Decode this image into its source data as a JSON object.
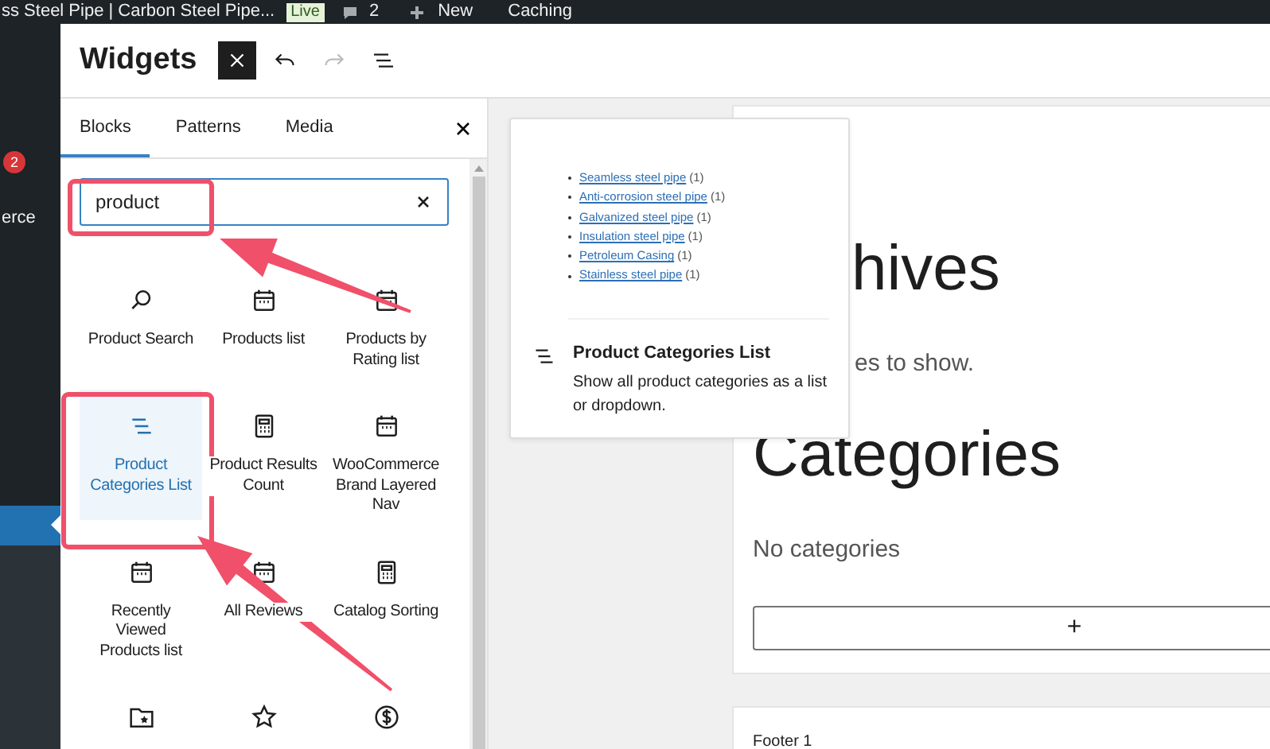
{
  "admin_bar": {
    "site_title": "ss Steel Pipe | Carbon Steel Pipe...",
    "live_badge": "Live",
    "comments_count": "2",
    "new_label": "New",
    "caching_label": "Caching"
  },
  "admin_menu": {
    "items": [
      {
        "kind": "badge",
        "text": "2",
        "selected": false
      },
      {
        "kind": "label",
        "text": "erce",
        "selected": false
      },
      {
        "kind": "blank",
        "selected": true
      }
    ]
  },
  "header": {
    "title": "Widgets",
    "tools": [
      {
        "kind": "close",
        "disabled": false
      },
      {
        "kind": "undo",
        "disabled": false
      },
      {
        "kind": "redo",
        "disabled": true
      },
      {
        "kind": "list-view",
        "disabled": false
      }
    ]
  },
  "inserter": {
    "tabs": [
      {
        "label": "Blocks",
        "selected": true
      },
      {
        "label": "Patterns",
        "selected": false
      },
      {
        "label": "Media",
        "selected": false
      }
    ],
    "search": {
      "value": "product"
    },
    "blocks": [
      {
        "label": "Product Search",
        "kind": "search",
        "selected": false
      },
      {
        "label": "Products list",
        "kind": "calendar",
        "selected": false
      },
      {
        "label": "Products by Rating list",
        "kind": "calendar",
        "selected": false
      },
      {
        "label": "Product Categories List",
        "kind": "lines",
        "selected": true
      },
      {
        "label": "Product Results Count",
        "kind": "calculator",
        "selected": false
      },
      {
        "label": "WooCommerce Brand Layered Nav",
        "kind": "calendar",
        "selected": false
      },
      {
        "label": "Recently Viewed Products list",
        "kind": "calendar",
        "selected": false
      },
      {
        "label": "All Reviews",
        "kind": "calendar",
        "selected": false
      },
      {
        "label": "Catalog Sorting",
        "kind": "calculator",
        "selected": false
      },
      {
        "kind": "folder-star",
        "selected": false
      },
      {
        "kind": "star",
        "selected": false
      },
      {
        "kind": "dollar",
        "selected": false
      }
    ]
  },
  "preview": {
    "items": [
      {
        "label": "Seamless steel pipe",
        "count": "(1)"
      },
      {
        "label": "Anti-corrosion steel pipe",
        "count": "(1)"
      },
      {
        "label": "Galvanized steel pipe",
        "count": "(1)"
      },
      {
        "label": "Insulation steel pipe",
        "count": "(1)"
      },
      {
        "label": "Petroleum Casing",
        "count": "(1)"
      },
      {
        "label": "Stainless steel pipe",
        "count": "(1)"
      }
    ],
    "title": "Product Categories List",
    "description": "Show all product categories as a list or dropdown."
  },
  "canvas": {
    "heading_1": "hives",
    "text_1": "es to show.",
    "heading_2": "Categories",
    "text_2": "No categories",
    "add_button": "+",
    "footer_title": "Footer 1"
  }
}
